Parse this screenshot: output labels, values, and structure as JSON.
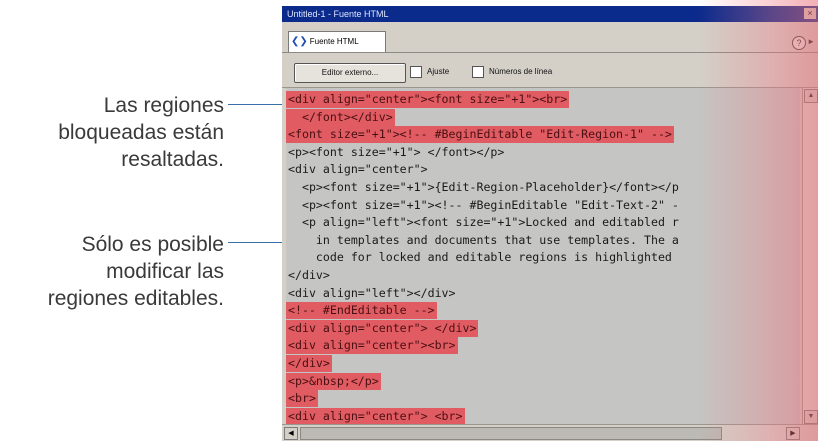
{
  "callouts": {
    "locked": [
      "Las regiones",
      "bloqueadas están",
      "resaltadas."
    ],
    "editable": [
      "Sólo es posible",
      "modificar las",
      "regiones editables."
    ]
  },
  "window": {
    "title": "Untitled-1 - Fuente HTML",
    "tab_label": "Fuente HTML",
    "help": "?",
    "close": "×"
  },
  "toolbar": {
    "edit_button": "Editor externo...",
    "wrap_label": "Ajuste",
    "line_numbers_label": "Números de línea"
  },
  "code_lines": [
    {
      "text": "<div align=\"center\"><font size=\"+1\"><br>",
      "locked": true
    },
    {
      "text": "  </font></div>",
      "locked": true
    },
    {
      "text": "<font size=\"+1\"><!-- #BeginEditable \"Edit-Region-1\" -->",
      "locked": true
    },
    {
      "text": "<p><font size=\"+1\"> </font></p>",
      "locked": false
    },
    {
      "text": "<div align=\"center\">",
      "locked": false
    },
    {
      "text": "  <p><font size=\"+1\">{Edit-Region-Placeholder}</font></p",
      "locked": false
    },
    {
      "text": "  <p><font size=\"+1\"><!-- #BeginEditable \"Edit-Text-2\" -",
      "locked": false
    },
    {
      "text": "  <p align=\"left\"><font size=\"+1\">Locked and editabled r",
      "locked": false
    },
    {
      "text": "    in templates and documents that use templates. The a",
      "locked": false
    },
    {
      "text": "    code for locked and editable regions is highlighted",
      "locked": false
    },
    {
      "text": "</div>",
      "locked": false
    },
    {
      "text": "<div align=\"left\"></div>",
      "locked": false
    },
    {
      "text": "<!-- #EndEditable -->",
      "locked": true
    },
    {
      "text": "<div align=\"center\"> </div>",
      "locked": true
    },
    {
      "text": "<div align=\"center\"><br>",
      "locked": true
    },
    {
      "text": "</div>",
      "locked": true
    },
    {
      "text": "<p>&nbsp;</p>",
      "locked": true
    },
    {
      "text": "<br>",
      "locked": true
    },
    {
      "text": "<div align=\"center\"> <br>",
      "locked": true
    }
  ],
  "colors": {
    "locked_highlight": "#e05c62",
    "editor_background": "#c5c5c3",
    "titlebar": "#0b2b8c"
  }
}
